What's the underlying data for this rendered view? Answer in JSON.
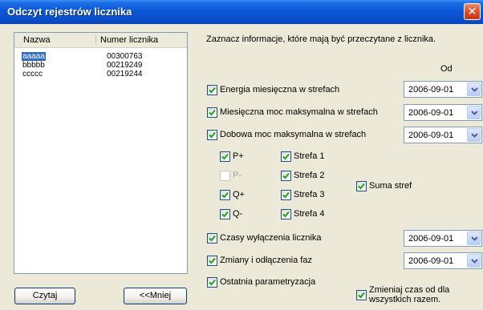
{
  "window": {
    "title": "Odczyt rejestrów licznika",
    "close_glyph": "✕"
  },
  "list": {
    "columns": [
      "Nazwa",
      "Numer licznika"
    ],
    "rows": [
      {
        "name": "aaaaa",
        "number": "00300763",
        "selected": true
      },
      {
        "name": "bbbbb",
        "number": "00219249",
        "selected": false
      },
      {
        "name": "ccccc",
        "number": "00219244",
        "selected": false
      }
    ]
  },
  "buttons": {
    "read_label": "Czytaj",
    "less_label": "<<Mniej"
  },
  "instructions": "Zaznacz informacje, które mają być przeczytane z licznika.",
  "od_label": "Od",
  "options": {
    "energia": {
      "label": "Energia miesięczna w strefach",
      "checked": true,
      "date": "2006-09-01"
    },
    "moc_mies": {
      "label": "Miesięczna moc maksymalna w strefach",
      "checked": true,
      "date": "2006-09-01"
    },
    "moc_dob": {
      "label": "Dobowa moc maksymalna w strefach",
      "checked": true,
      "date": "2006-09-01"
    },
    "czasy": {
      "label": "Czasy wyłączenia licznika",
      "checked": true,
      "date": "2006-09-01"
    },
    "zmiany": {
      "label": "Zmiany i odłączenia faz",
      "checked": true,
      "date": "2006-09-01"
    },
    "param": {
      "label": "Ostatnia parametryzacja",
      "checked": true
    }
  },
  "quantities": {
    "p_plus": {
      "label": "P+",
      "checked": true,
      "enabled": true
    },
    "p_minus": {
      "label": "P-",
      "checked": false,
      "enabled": false
    },
    "q_plus": {
      "label": "Q+",
      "checked": true,
      "enabled": true
    },
    "q_minus": {
      "label": "Q-",
      "checked": true,
      "enabled": true
    }
  },
  "zones": {
    "s1": {
      "label": "Strefa 1",
      "checked": true
    },
    "s2": {
      "label": "Strefa 2",
      "checked": true
    },
    "s3": {
      "label": "Strefa 3",
      "checked": true
    },
    "s4": {
      "label": "Strefa 4",
      "checked": true
    }
  },
  "suma": {
    "label": "Suma stref",
    "checked": true
  },
  "change_all": {
    "label": "Zmieniaj czas od dla wszystkich razem.",
    "checked": true
  },
  "colors": {
    "title_bar": "#0a4fcb",
    "selection": "#316ac5",
    "check": "#21a121",
    "dialog": "#ece9d8"
  },
  "icons": {
    "close": "close-icon",
    "check": "checkmark-icon",
    "dropdown": "chevron-down-icon"
  }
}
